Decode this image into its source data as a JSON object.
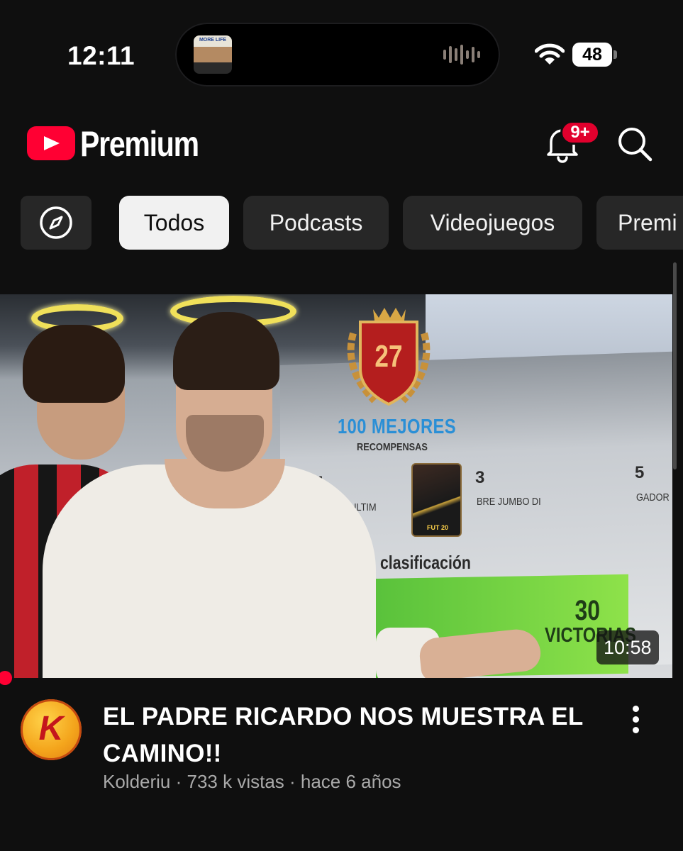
{
  "status_bar": {
    "time": "12:11",
    "now_playing_art_text": "MORE LIFE",
    "battery": "48"
  },
  "header": {
    "brand": "Premium",
    "notifications_badge": "9+",
    "icons": [
      "youtube-logo-icon",
      "bell-icon",
      "search-icon"
    ]
  },
  "chips": [
    {
      "label": "Todos",
      "active": true
    },
    {
      "label": "Podcasts",
      "active": false
    },
    {
      "label": "Videojuegos",
      "active": false
    },
    {
      "label": "Premi",
      "active": false
    }
  ],
  "thumbnail": {
    "rank": "27",
    "heading": "100 MEJORES",
    "subheading": "RECOMPENSAS",
    "rewards": [
      {
        "num": "1",
        "label": "OTW ULTIM"
      },
      {
        "num": "3",
        "label": "BRE JUMBO DI"
      },
      {
        "num": "5",
        "label": "GADOR EL"
      }
    ],
    "card_text": "FUT 20",
    "section_label": "o clasificación",
    "victory_number": "30",
    "victory_label": "VICTORIAS"
  },
  "video": {
    "duration": "10:58",
    "title": "EL PADRE RICARDO NOS MUESTRA EL CAMINO!!",
    "avatar_letter": "K",
    "meta": "Kolderiu · 733 k vistas · hace 6 años"
  },
  "colors": {
    "background": "#0f0f0f",
    "brand_red": "#ff0033",
    "chip": "#272727",
    "chip_active": "#f1f1f1",
    "meta_text": "#aaaaaa"
  }
}
